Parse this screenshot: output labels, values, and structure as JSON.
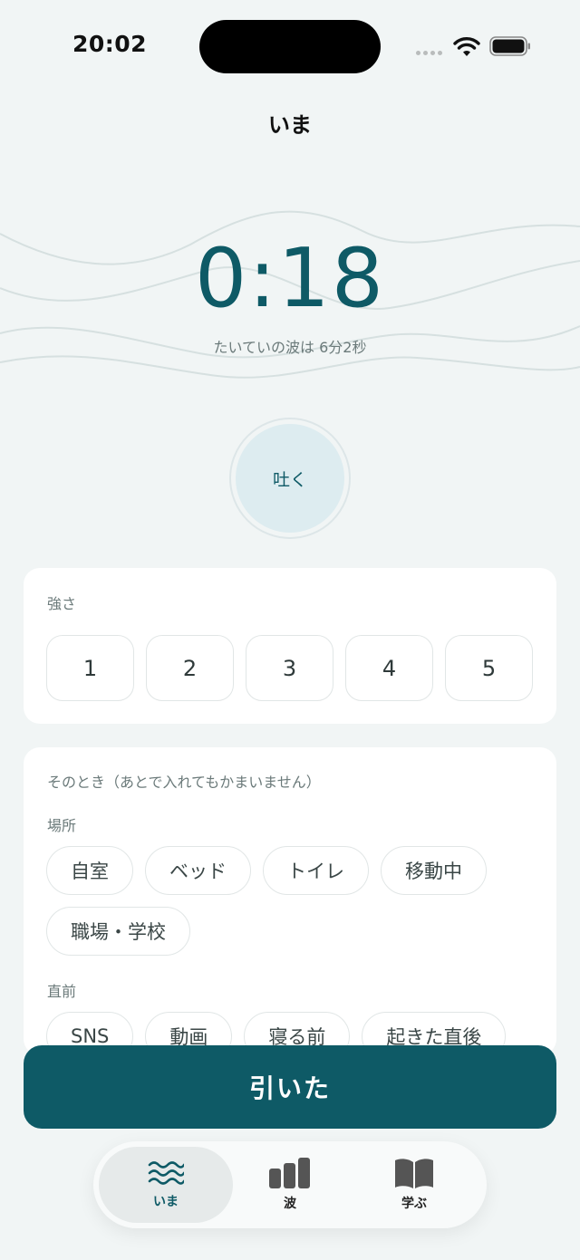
{
  "status_bar": {
    "time": "20:02"
  },
  "nav": {
    "title": "いま"
  },
  "timer": {
    "value": "0:18",
    "caption": "たいていの波は 6分2秒"
  },
  "breath": {
    "label": "吐く"
  },
  "strength": {
    "label": "強さ",
    "options": [
      "1",
      "2",
      "3",
      "4",
      "5"
    ]
  },
  "context": {
    "label": "そのとき（あとで入れてもかまいません）",
    "place": {
      "label": "場所",
      "options": [
        "自室",
        "ベッド",
        "トイレ",
        "移動中",
        "職場・学校"
      ]
    },
    "before": {
      "label": "直前",
      "options": [
        "SNS",
        "動画",
        "寝る前",
        "起きた直後"
      ]
    }
  },
  "primary_button": {
    "label": "引いた"
  },
  "tabs": [
    {
      "label": "いま",
      "icon": "waves-icon",
      "active": true
    },
    {
      "label": "波",
      "icon": "bar-chart-icon",
      "active": false
    },
    {
      "label": "学ぶ",
      "icon": "book-icon",
      "active": false
    }
  ],
  "colors": {
    "accent": "#0e5a66",
    "background": "#f1f5f5",
    "breath_fill": "#ddecf0"
  }
}
